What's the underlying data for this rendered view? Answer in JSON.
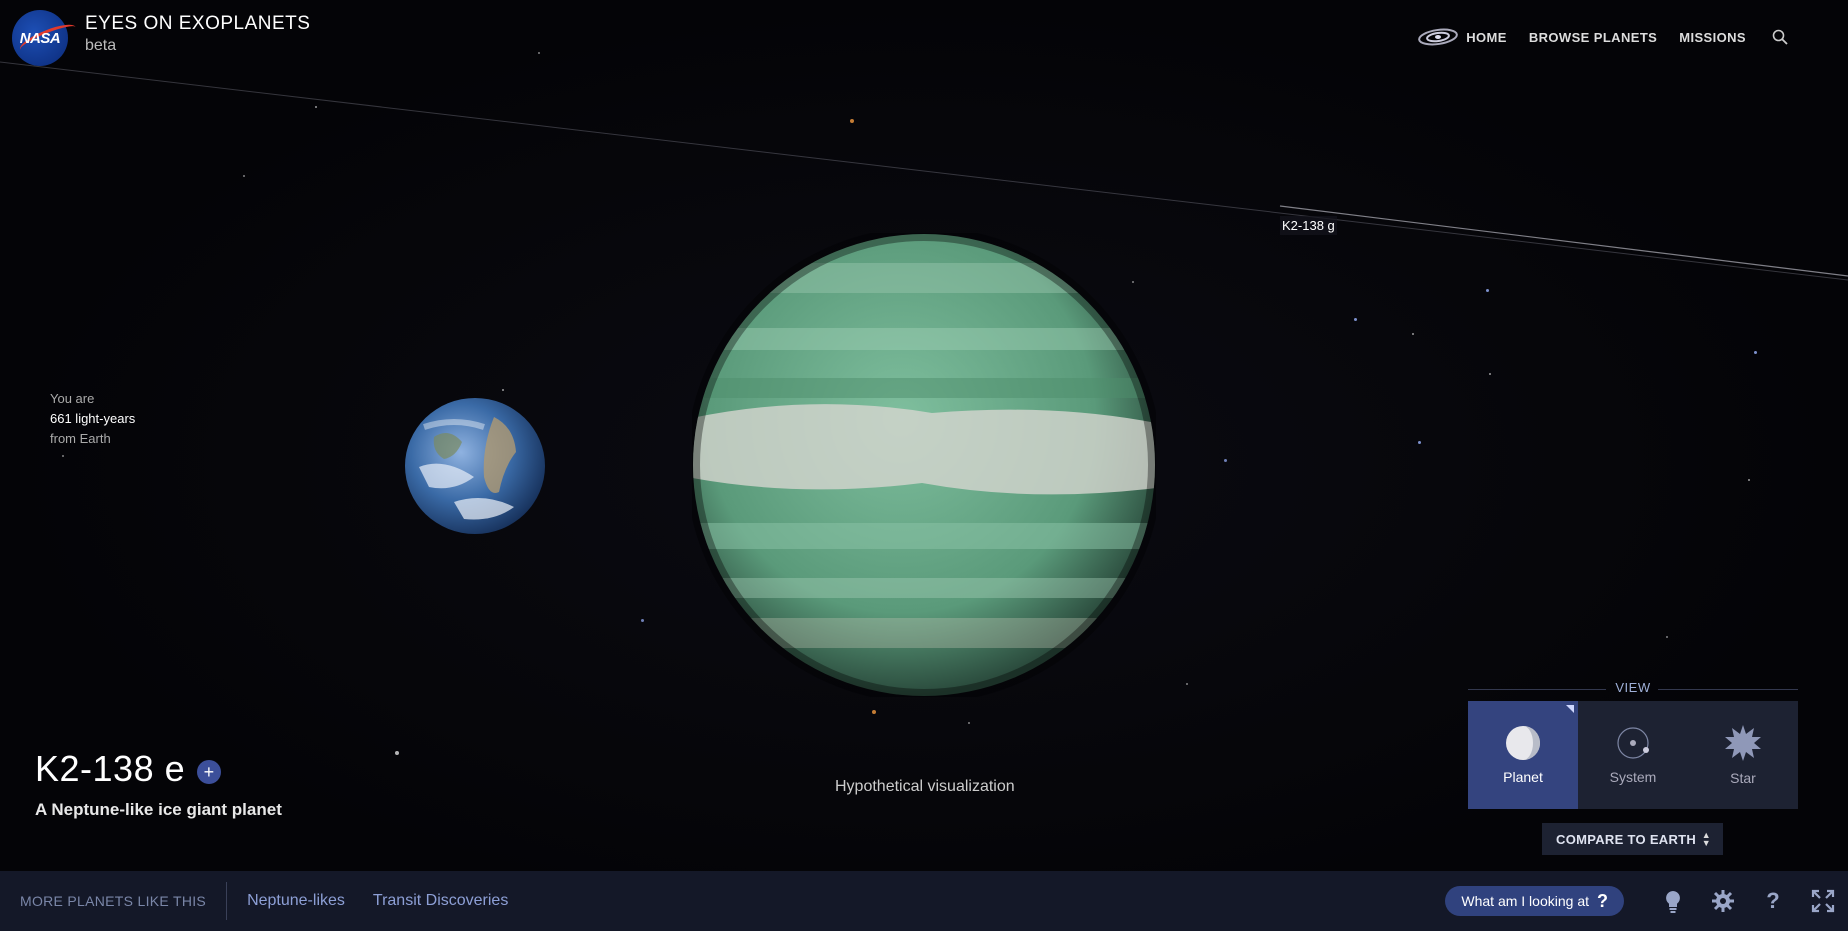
{
  "header": {
    "logo_text": "NASA",
    "app_title": "EYES ON EXOPLANETS",
    "app_subtitle": "beta"
  },
  "nav": {
    "home": "HOME",
    "browse": "BROWSE PLANETS",
    "missions": "MISSIONS",
    "search_icon": "search-icon",
    "home_icon": "galaxy-icon"
  },
  "distance": {
    "line1": "You are",
    "value": "661 light-years",
    "line3": "from Earth"
  },
  "orbit_label": "K2-138 g",
  "planet": {
    "name": "K2-138 e",
    "plus": "+",
    "description": "A Neptune-like ice giant planet",
    "caption": "Hypothetical visualization"
  },
  "view": {
    "label": "VIEW",
    "buttons": [
      {
        "label": "Planet",
        "icon": "planet-icon",
        "active": true
      },
      {
        "label": "System",
        "icon": "system-icon",
        "active": false
      },
      {
        "label": "Star",
        "icon": "star-icon",
        "active": false
      }
    ]
  },
  "compare": {
    "label": "COMPARE TO EARTH"
  },
  "bottom": {
    "more_title": "MORE PLANETS LIKE THIS",
    "links": [
      "Neptune-likes",
      "Transit Discoveries"
    ],
    "what_label": "What am I looking at",
    "what_q": "?",
    "tools": [
      "lightbulb-icon",
      "gear-icon",
      "help-icon",
      "fullscreen-icon"
    ],
    "help_glyph": "?"
  },
  "colors": {
    "accent": "#34447f",
    "bar": "#141828",
    "link": "#8d9fd6",
    "planet_green": "#6aa98a",
    "nasa_blue": "#1d4fb5",
    "nasa_red": "#e23a2c"
  }
}
